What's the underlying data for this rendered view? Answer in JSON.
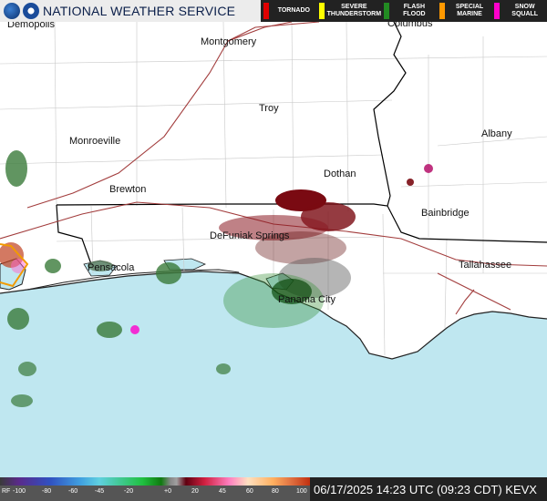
{
  "header": {
    "title": "NATIONAL WEATHER SERVICE",
    "logos": [
      "noaa-logo",
      "nws-logo"
    ]
  },
  "legend": [
    {
      "label": "TORNADO",
      "color": "#e00000"
    },
    {
      "label": "SEVERE\nTHUNDERSTORM",
      "color": "#ffff00"
    },
    {
      "label": "FLASH\nFLOOD",
      "color": "#228b22"
    },
    {
      "label": "SPECIAL\nMARINE",
      "color": "#ff9900"
    },
    {
      "label": "SNOW\nSQUALL",
      "color": "#ff00cc"
    }
  ],
  "cities": [
    {
      "name": "Demopolis"
    },
    {
      "name": "Montgomery"
    },
    {
      "name": "Columbus"
    },
    {
      "name": "Troy"
    },
    {
      "name": "Monroeville"
    },
    {
      "name": "Albany"
    },
    {
      "name": "Dothan"
    },
    {
      "name": "Brewton"
    },
    {
      "name": "Bainbridge"
    },
    {
      "name": "DeFuniak Springs"
    },
    {
      "name": "Pensacola"
    },
    {
      "name": "Tallahassee"
    },
    {
      "name": "Panama City"
    }
  ],
  "colors": {
    "land": "#ffffff",
    "water": "#bfe7f0",
    "county_lines": "#c8c8c8",
    "state_lines": "#000000",
    "highways": "#a23c3c",
    "shoreline": "#1a1a1a"
  },
  "scale": {
    "labels": [
      "RF",
      "-100",
      "-80",
      "-60",
      "-45",
      "-20",
      "+0",
      "20",
      "45",
      "60",
      "80",
      "100"
    ]
  },
  "footer": {
    "timestamp": "06/17/2025 14:23 UTC (09:23 CDT) KEVX"
  }
}
